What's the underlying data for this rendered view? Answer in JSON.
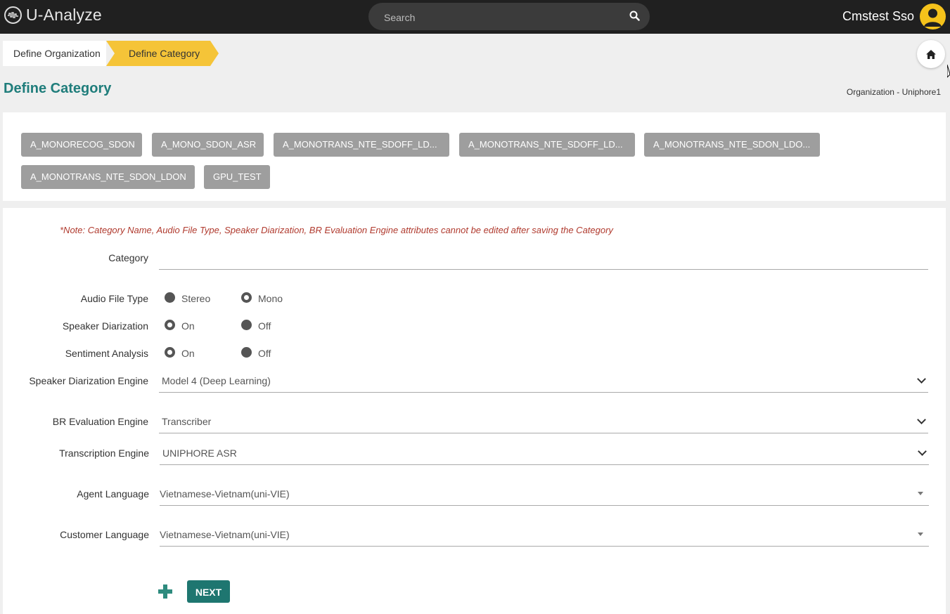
{
  "header": {
    "app_name": "U-Analyze",
    "search_placeholder": "Search",
    "user_name": "Cmstest Sso"
  },
  "breadcrumb": {
    "items": [
      {
        "label": "Define Organization"
      },
      {
        "label": "Define Category"
      }
    ]
  },
  "page": {
    "title": "Define Category",
    "organization_label": "Organization - Uniphore1"
  },
  "categories": [
    "A_MONORECOG_SDON",
    "A_MONO_SDON_ASR",
    "A_MONOTRANS_NTE_SDOFF_LD...",
    "A_MONOTRANS_NTE_SDOFF_LD...",
    "A_MONOTRANS_NTE_SDON_LDO...",
    "A_MONOTRANS_NTE_SDON_LDON",
    "GPU_TEST"
  ],
  "form": {
    "note": "*Note: Category Name, Audio File Type, Speaker Diarization, BR Evaluation Engine attributes cannot be edited after saving the Category",
    "category": {
      "label": "Category",
      "value": ""
    },
    "audio_file_type": {
      "label": "Audio File Type",
      "options": [
        "Stereo",
        "Mono"
      ],
      "selected": "Mono"
    },
    "speaker_diarization": {
      "label": "Speaker Diarization",
      "options": [
        "On",
        "Off"
      ],
      "selected": "On"
    },
    "sentiment_analysis": {
      "label": "Sentiment Analysis",
      "options": [
        "On",
        "Off"
      ],
      "selected": "On"
    },
    "speaker_diarization_engine": {
      "label": "Speaker Diarization Engine",
      "value": "Model 4 (Deep Learning)"
    },
    "br_evaluation_engine": {
      "label": "BR Evaluation Engine",
      "value": "Transcriber"
    },
    "transcription_engine": {
      "label": "Transcription Engine",
      "value": "UNIPHORE ASR"
    },
    "agent_language": {
      "label": "Agent Language",
      "value": "Vietnamese-Vietnam(uni-VIE)"
    },
    "customer_language": {
      "label": "Customer Language",
      "value": "Vietnamese-Vietnam(uni-VIE)"
    },
    "next_label": "NEXT"
  },
  "colors": {
    "accent": "#1f7d7b",
    "active_crumb": "#f5c438",
    "chip_bg": "#9e9e9e",
    "note": "#b03a2e"
  }
}
